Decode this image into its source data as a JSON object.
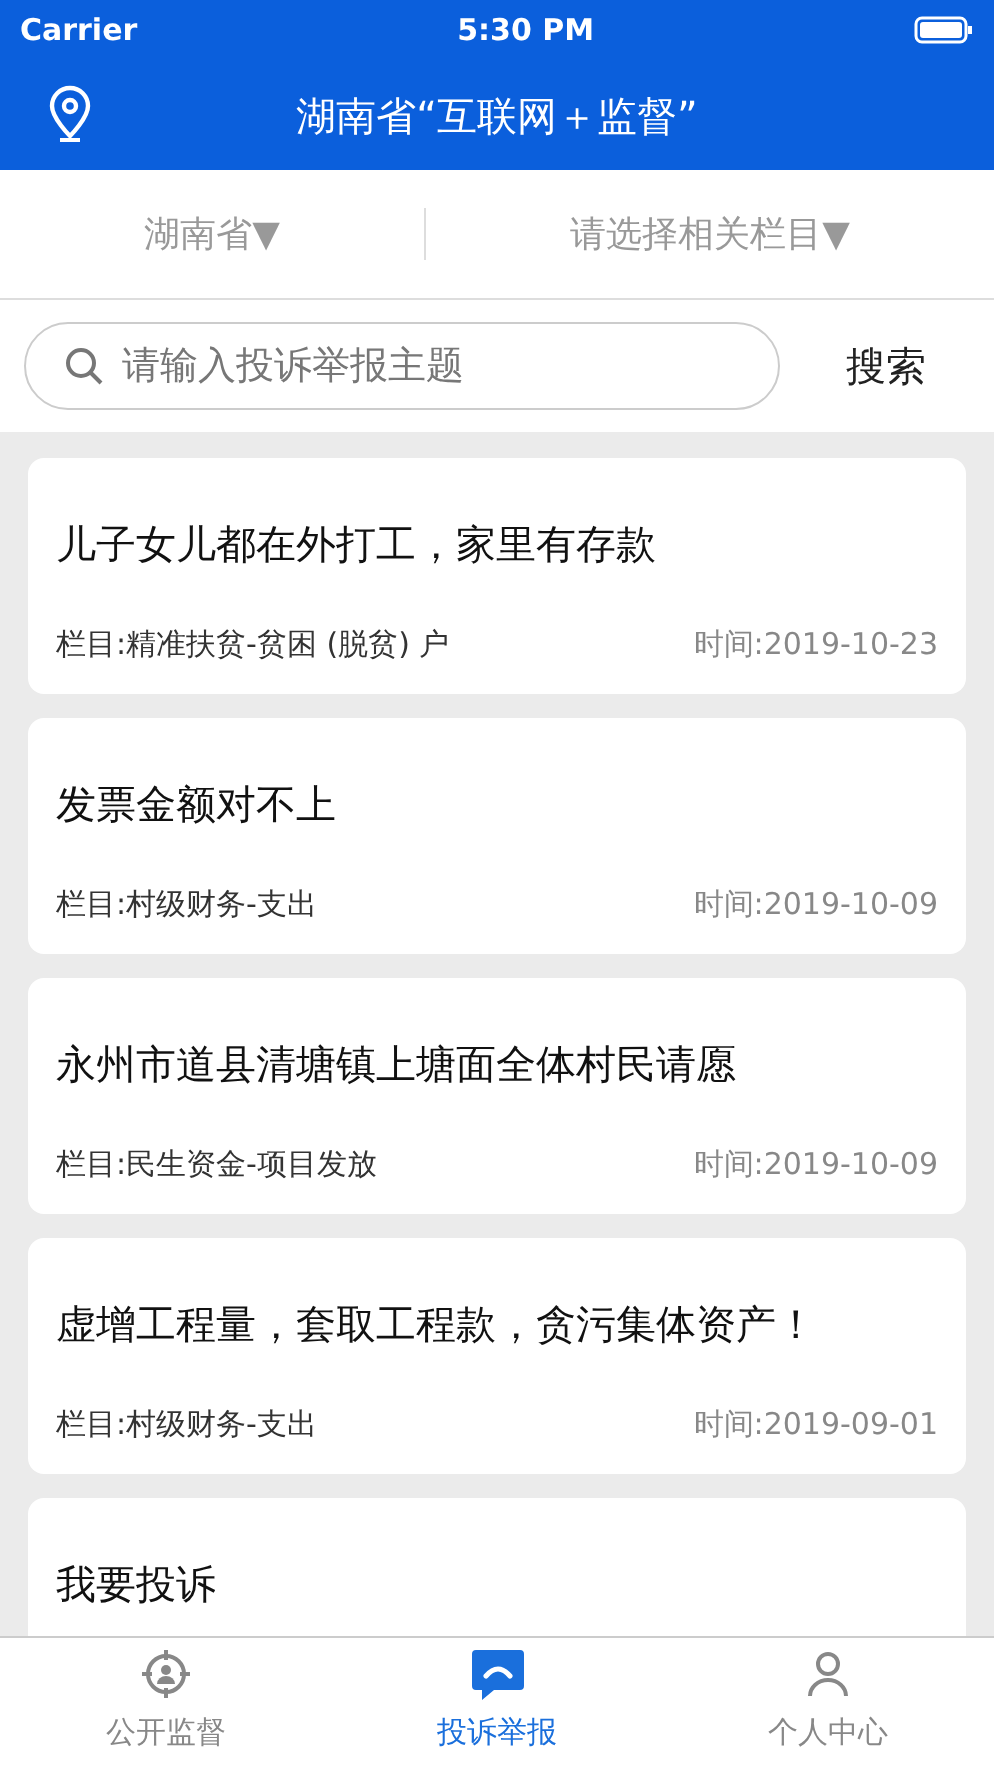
{
  "status_bar": {
    "carrier": "Carrier",
    "time": "5:30 PM"
  },
  "header": {
    "title": "湖南省“互联网＋监督”"
  },
  "filters": [
    {
      "label": "湖南省▼"
    },
    {
      "label": "请选择相关栏目▼"
    }
  ],
  "search": {
    "placeholder": "请输入投诉举报主题",
    "button": "搜索"
  },
  "items": [
    {
      "title": "儿子女儿都在外打工，家里有存款",
      "category": "栏目:精准扶贫-贫困 (脱贫) 户",
      "time": "时间:2019-10-23"
    },
    {
      "title": "发票金额对不上",
      "category": "栏目:村级财务-支出",
      "time": "时间:2019-10-09"
    },
    {
      "title": "永州市道县清塘镇上塘面全体村民请愿",
      "category": "栏目:民生资金-项目发放",
      "time": "时间:2019-10-09"
    },
    {
      "title": "虚增工程量，套取工程款，贪污集体资产！",
      "category": "栏目:村级财务-支出",
      "time": "时间:2019-09-01"
    },
    {
      "title": "我要投诉"
    }
  ],
  "tabs": [
    {
      "label": "公开监督",
      "kind": "target",
      "selected": false
    },
    {
      "label": "投诉举报",
      "kind": "chat",
      "selected": true
    },
    {
      "label": "个人中心",
      "kind": "person",
      "selected": false
    }
  ]
}
